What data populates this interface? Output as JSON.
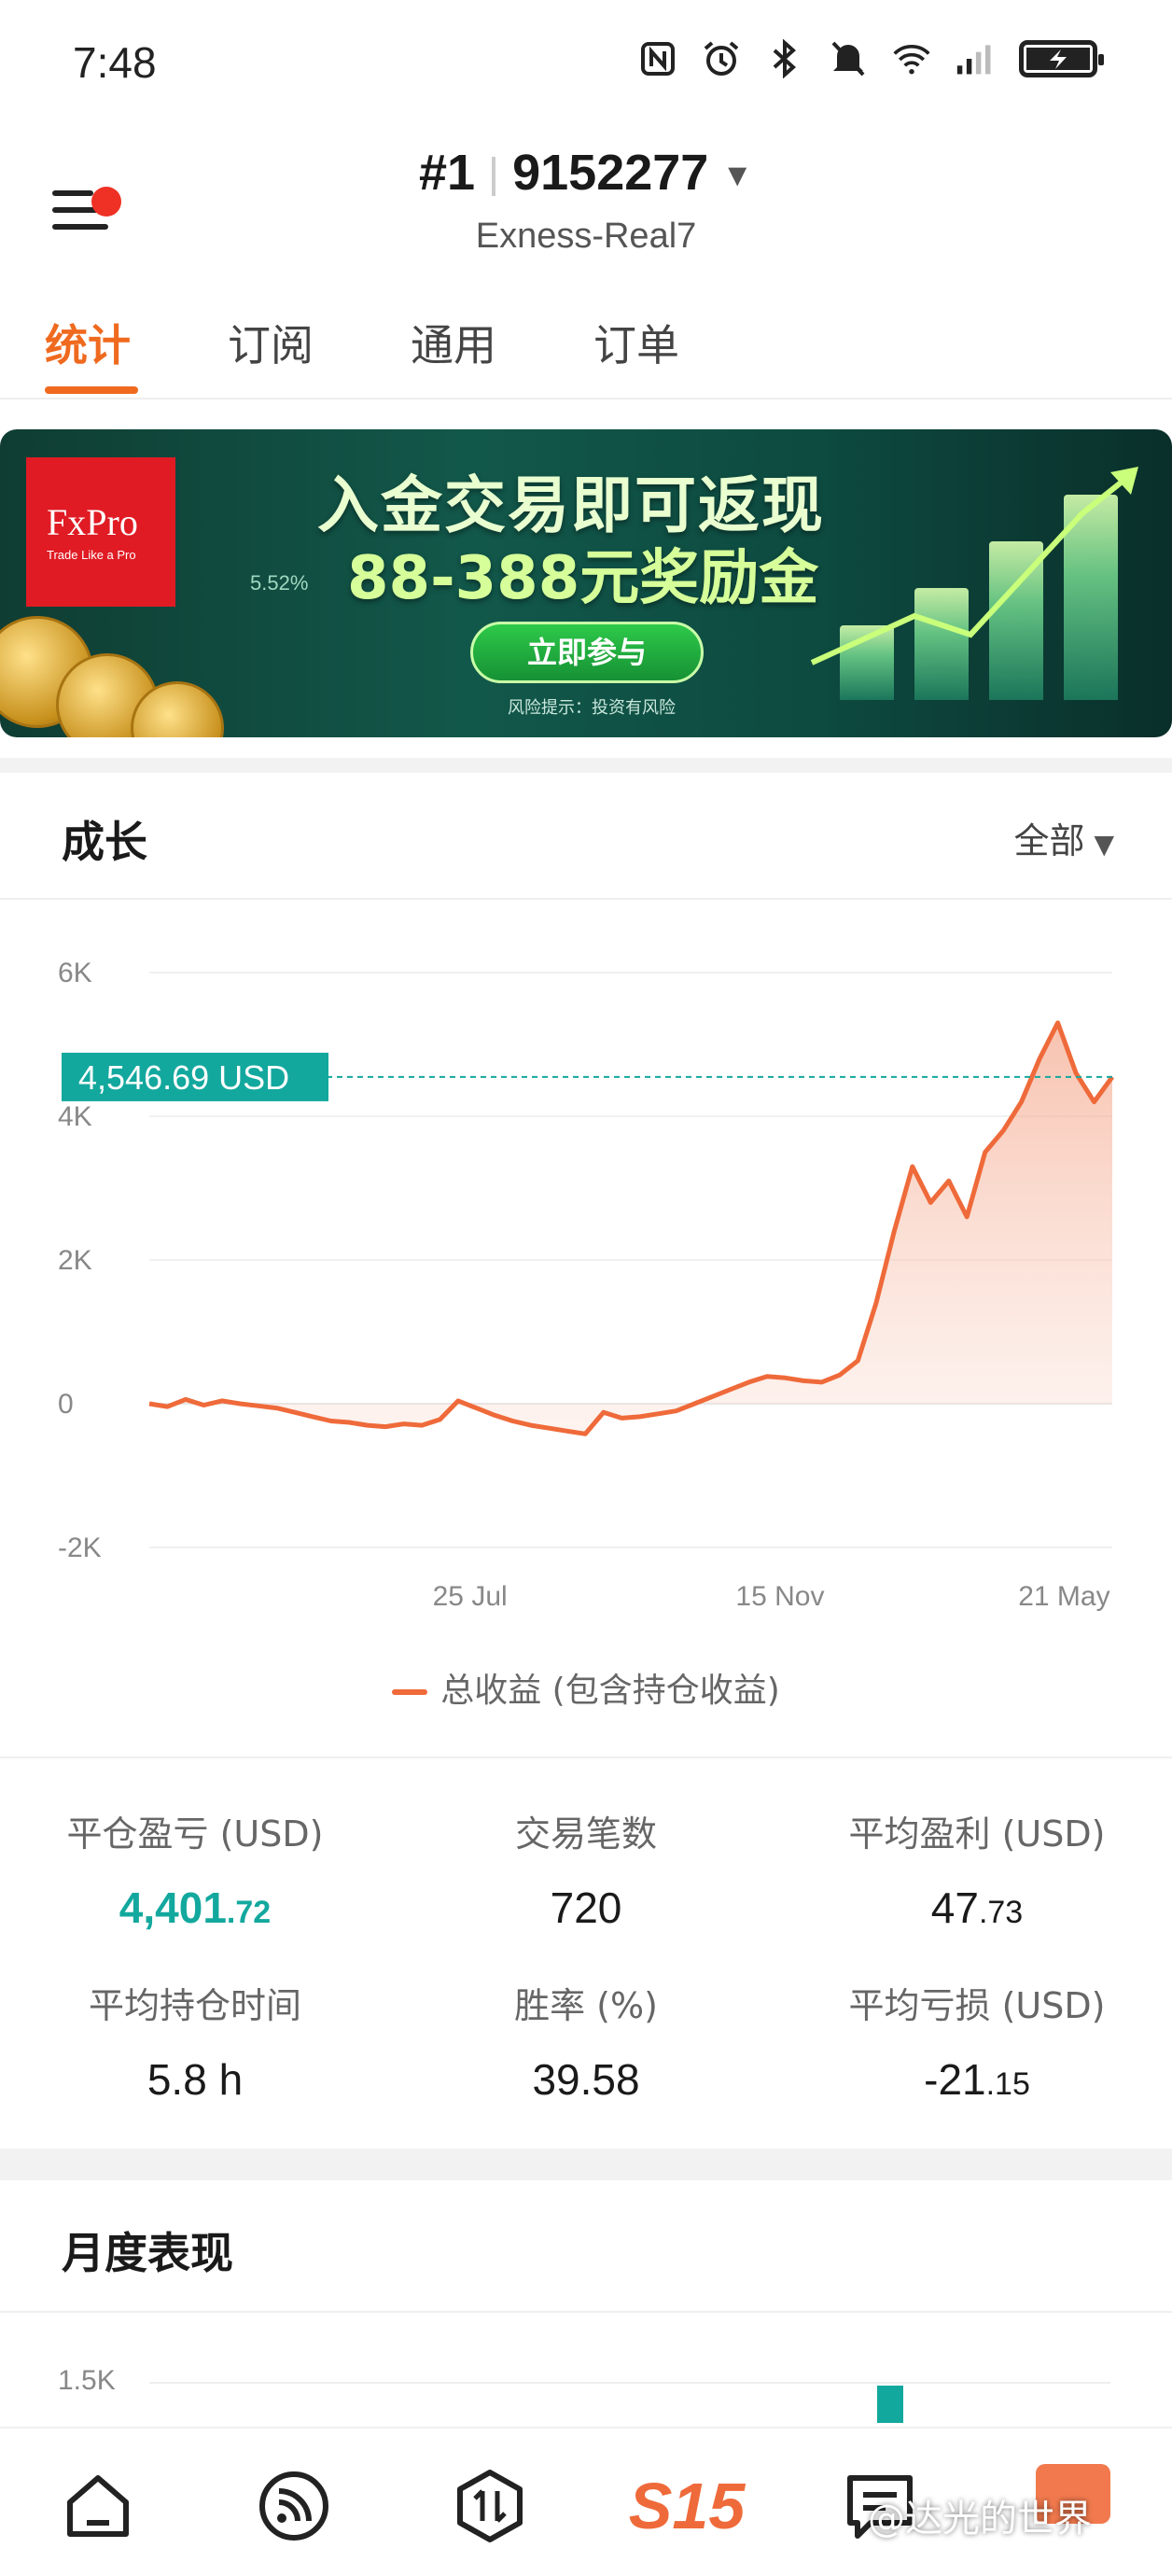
{
  "status_bar": {
    "time": "7:48",
    "icons": [
      "nfc-icon",
      "alarm-icon",
      "bluetooth-icon",
      "mute-icon",
      "wifi-icon",
      "signal-icon",
      "battery-charging-icon"
    ]
  },
  "header": {
    "account_prefix": "#1",
    "account_number": "9152277",
    "server": "Exness-Real7",
    "notification_dot": true
  },
  "tabs": [
    {
      "label": "统计",
      "active": true
    },
    {
      "label": "订阅",
      "active": false
    },
    {
      "label": "通用",
      "active": false
    },
    {
      "label": "订单",
      "active": false
    }
  ],
  "banner": {
    "logo": "FxPro",
    "logo_tagline": "Trade Like a Pro",
    "headline": "入金交易即可返现",
    "subline": "88-388元奖励金",
    "percent": "5.52%",
    "cta": "立即参与",
    "risk_note": "风险提示：投资有风险"
  },
  "growth": {
    "title": "成长",
    "filter": "全部",
    "current_value_label": "4,546.69 USD",
    "legend": "总收益 (包含持仓收益)",
    "colors": {
      "line": "#ef6a3a",
      "marker": "#13a89e"
    }
  },
  "chart_data": {
    "type": "area",
    "title": "",
    "xlabel": "",
    "ylabel": "",
    "ylim": [
      -2000,
      6000
    ],
    "y_ticks": [
      "6K",
      "4K",
      "2K",
      "0",
      "-2K"
    ],
    "y_tick_values": [
      6000,
      4000,
      2000,
      0,
      -2000
    ],
    "x_ticks": [
      "25 Jul",
      "15 Nov",
      "21 May"
    ],
    "x_tick_positions": [
      0.333,
      0.655,
      0.95
    ],
    "series": [
      {
        "values": [
          0,
          -40,
          60,
          -20,
          40,
          0,
          -30,
          -60,
          -120,
          -180,
          -240,
          -260,
          -300,
          -320,
          -280,
          -300,
          -220,
          40,
          -60,
          -160,
          -240,
          -300,
          -340,
          -380,
          -420,
          -120,
          -200,
          -180,
          -140,
          -100,
          0,
          100,
          200,
          300,
          380,
          360,
          320,
          300,
          400,
          600,
          1400,
          2400,
          3300,
          2800,
          3100,
          2600,
          3500,
          3800,
          4200,
          4800,
          5300,
          4600,
          4200,
          4546.69
        ]
      }
    ],
    "current_value": 4546.69,
    "grid": true
  },
  "stats": [
    {
      "label": "平仓盈亏 (USD)",
      "int": "4,401",
      "dec": ".72",
      "positive": true
    },
    {
      "label": "交易笔数",
      "int": "720",
      "dec": "",
      "positive": false
    },
    {
      "label": "平均盈利 (USD)",
      "int": "47",
      "dec": ".73",
      "positive": false
    },
    {
      "label": "平均持仓时间",
      "int": "5.8 h",
      "dec": "",
      "positive": false
    },
    {
      "label": "胜率 (%)",
      "int": "39.58",
      "dec": "",
      "positive": false
    },
    {
      "label": "平均亏损 (USD)",
      "int": "-21",
      "dec": ".15",
      "positive": false
    }
  ],
  "monthly": {
    "title": "月度表现",
    "first_tick": "1.5K"
  },
  "bottom_nav": {
    "items": [
      "home-icon",
      "feed-icon",
      "trade-icon",
      "s15-logo",
      "message-icon"
    ],
    "s15_label": "S15",
    "badge_text": "",
    "watermark": "@达光的世界"
  }
}
